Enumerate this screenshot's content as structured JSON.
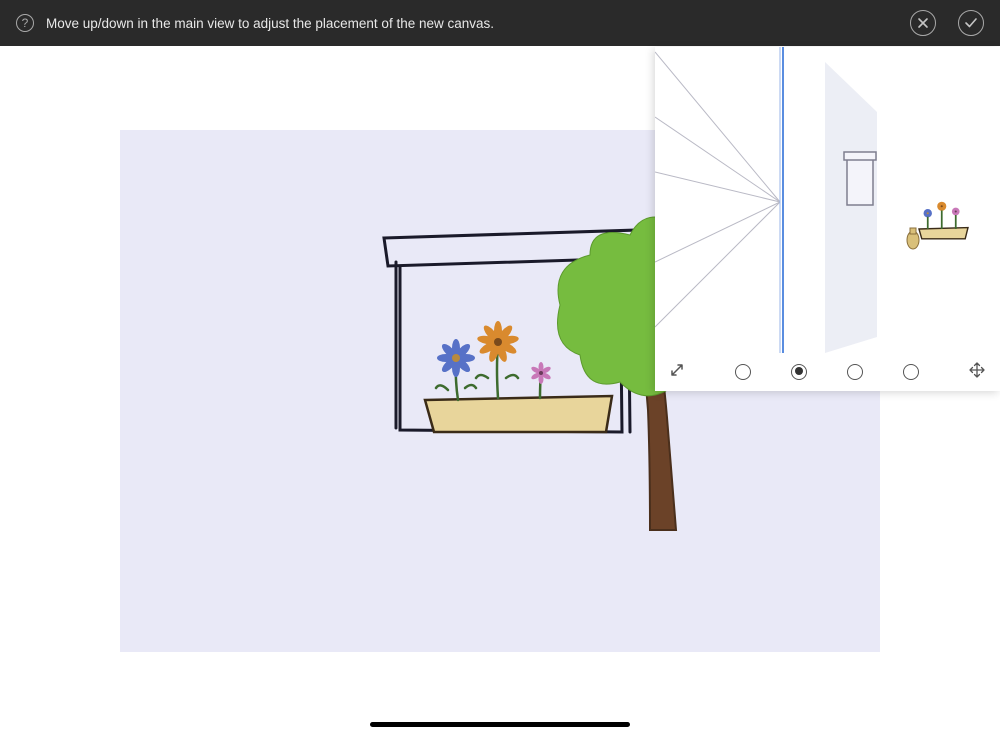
{
  "topbar": {
    "hint": "Move up/down in the main view to adjust the placement of the new canvas.",
    "help_label": "?",
    "cancel_label": "Cancel",
    "confirm_label": "Confirm"
  },
  "canvas": {
    "background": "#e9e9f7"
  },
  "perspective": {
    "expand_label": "Resize",
    "move_label": "Move",
    "selected_dot_index": 1,
    "dot_count": 4
  },
  "icons": {
    "help": "help-icon",
    "close": "close-icon",
    "check": "check-icon",
    "expand": "expand-diagonal-icon",
    "move": "move-icon"
  }
}
